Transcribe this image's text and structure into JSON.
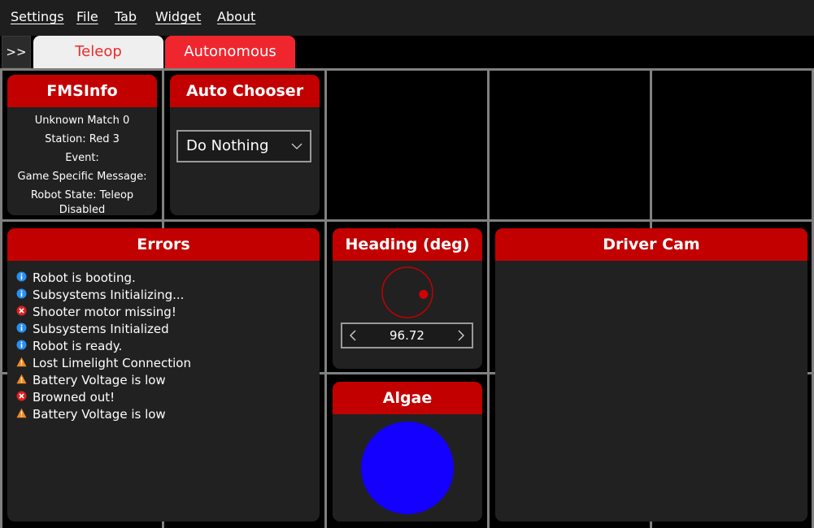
{
  "menu": {
    "items": [
      {
        "label": "Settings",
        "icon": "",
        "first_underlined": "S"
      },
      {
        "label": "File"
      },
      {
        "label": "Tab"
      },
      {
        "label": "Widget"
      },
      {
        "label": "About"
      }
    ]
  },
  "tabs": {
    "expand_label": ">>",
    "items": [
      {
        "label": "Teleop",
        "selected": true
      },
      {
        "label": "Autonomous",
        "selected": false
      }
    ]
  },
  "fms": {
    "title": "FMSInfo",
    "lines": [
      "Unknown Match 0",
      "Station: Red 3",
      "Event:",
      "Game Specific Message:",
      "Robot State: Teleop Disabled"
    ]
  },
  "auto_chooser": {
    "title": "Auto Chooser",
    "selected": "Do Nothing"
  },
  "errors": {
    "title": "Errors",
    "items": [
      {
        "level": "info",
        "icon": "info-icon",
        "text": "Robot is booting."
      },
      {
        "level": "info",
        "icon": "info-icon",
        "text": "Subsystems Initializing..."
      },
      {
        "level": "error",
        "icon": "error-icon",
        "text": "Shooter motor missing!"
      },
      {
        "level": "info",
        "icon": "info-icon",
        "text": "Subsystems Initialized"
      },
      {
        "level": "info",
        "icon": "info-icon",
        "text": "Robot is ready."
      },
      {
        "level": "warning",
        "icon": "warning-icon",
        "text": "Lost Limelight Connection"
      },
      {
        "level": "warning",
        "icon": "warning-icon",
        "text": "Battery Voltage is low"
      },
      {
        "level": "error",
        "icon": "error-icon",
        "text": "Browned out!"
      },
      {
        "level": "warning",
        "icon": "warning-icon",
        "text": "Battery Voltage is low"
      }
    ]
  },
  "heading": {
    "title": "Heading (deg)",
    "value": "96.72",
    "degrees": 96.72
  },
  "algae": {
    "title": "Algae",
    "color": "#1400ff"
  },
  "driver_cam": {
    "title": "Driver Cam"
  },
  "colors": {
    "header_red": "#c20000",
    "tab_red": "#f0262e",
    "info_blue": "#2a8ff0",
    "error_red": "#e02020",
    "warning_orange": "#f08a20"
  }
}
